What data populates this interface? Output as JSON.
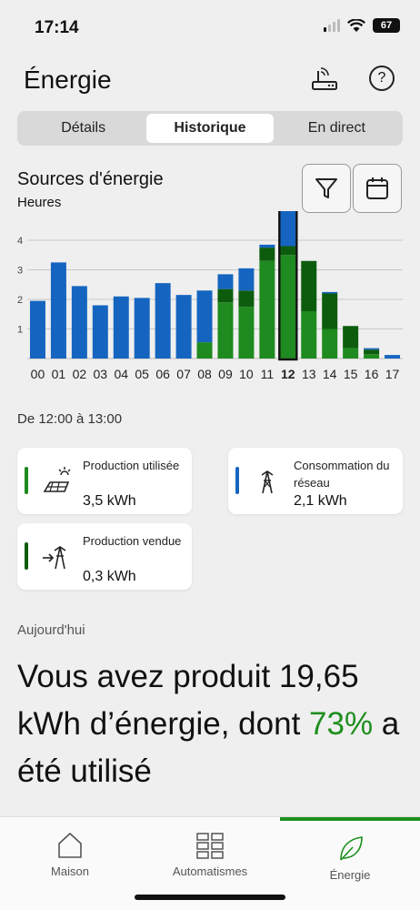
{
  "status": {
    "time": "17:14",
    "battery": "67"
  },
  "header": {
    "title": "Énergie",
    "help": "?"
  },
  "tabs": [
    {
      "label": "Détails",
      "active": false
    },
    {
      "label": "Historique",
      "active": true
    },
    {
      "label": "En direct",
      "active": false
    }
  ],
  "chart_header": {
    "title": "Sources d'énergie",
    "subtitle": "Heures"
  },
  "chart_data": {
    "type": "bar",
    "stacked": true,
    "categories": [
      "00",
      "01",
      "02",
      "03",
      "04",
      "05",
      "06",
      "07",
      "08",
      "09",
      "10",
      "11",
      "12",
      "13",
      "14",
      "15",
      "16",
      "17"
    ],
    "selected": "12",
    "ylabel": "Heures",
    "yticks": [
      1,
      2,
      3,
      4
    ],
    "ylim": [
      0,
      4.8
    ],
    "grid": true,
    "series": [
      {
        "color": "#1f8a1f",
        "values": [
          0,
          0,
          0,
          0,
          0,
          0,
          0,
          0,
          0.55,
          1.9,
          1.75,
          3.3,
          3.5,
          1.6,
          1.0,
          0.35,
          0.15,
          0
        ]
      },
      {
        "color": "#0d5c0d",
        "values": [
          0,
          0,
          0,
          0,
          0,
          0,
          0,
          0,
          0,
          0.45,
          0.55,
          0.45,
          0.3,
          1.7,
          1.2,
          0.75,
          0.15,
          0
        ]
      },
      {
        "color": "#1565c0",
        "values": [
          1.95,
          3.25,
          2.45,
          1.8,
          2.1,
          2.05,
          2.55,
          2.15,
          1.75,
          0.5,
          0.75,
          0.1,
          2.1,
          0,
          0.05,
          0,
          0.05,
          0.12
        ]
      }
    ]
  },
  "range_label": "De 12:00 à 13:00",
  "cards": {
    "production": {
      "label": "Production utilisée",
      "value": "3,5 kWh",
      "color": "#1f8a1f"
    },
    "consumption": {
      "label": "Consommation du réseau",
      "value": "2,1 kWh",
      "color": "#1565c0"
    },
    "sold": {
      "label": "Production vendue",
      "value": "0,3 kWh",
      "color": "#0d5c0d"
    }
  },
  "today": {
    "label": "Aujourd'hui",
    "text_before": "Vous avez produit 19,65 kWh d’énergie, dont ",
    "percent": "73%",
    "text_after": " a été utilisé"
  },
  "nav": [
    {
      "label": "Maison",
      "icon": "home-icon"
    },
    {
      "label": "Automatismes",
      "icon": "grid-icon"
    },
    {
      "label": "Énergie",
      "icon": "leaf-icon",
      "active": true
    }
  ]
}
